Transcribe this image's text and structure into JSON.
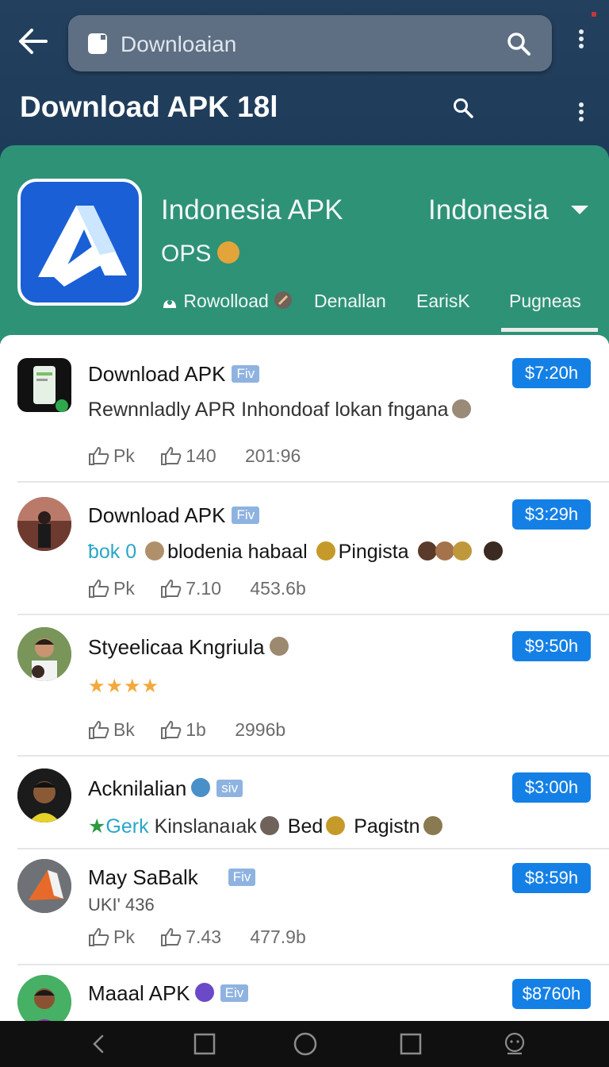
{
  "search": {
    "placeholder": "Downloaian"
  },
  "header": {
    "title": "Download APK 18l"
  },
  "app": {
    "name": "Indonesia APK",
    "subtitle": "OPS",
    "region": "Indonesia",
    "tabs": [
      "Rowolload",
      "Denallan",
      "EarisK",
      "Pugneas"
    ],
    "active_tab_index": 3
  },
  "colors": {
    "header_bg": "#23405e",
    "hero_bg": "#2e9277",
    "price_bg": "#1480e6",
    "tag_bg": "#8fb3e0"
  },
  "items": [
    {
      "title": "Download APK",
      "tag": "Fiv",
      "price": "$7:20h",
      "desc": "Rewnnladly APR Inhondoaf lokan fngana",
      "likes": "Pk",
      "rating": "140",
      "size": "201:96"
    },
    {
      "title": "Download APK",
      "tag": "Fiv",
      "price": "$3:29h",
      "desc_prefix": "ƀok 0",
      "desc_mid": "blodenia habaal",
      "desc_end": "Pingista",
      "likes": "Pk",
      "rating": "7.10",
      "size": "453.6b"
    },
    {
      "title": "Styeelicaa Kngriula",
      "price": "$9:50h",
      "stars": "★★★★",
      "likes": "Bk",
      "rating": "1b",
      "size": "2996b"
    },
    {
      "title": "Acknilalian",
      "tag": "siv",
      "price": "$3:00h",
      "desc_prefix": "Gerk",
      "desc_mid": "Kinslanaıak",
      "desc_bold1": "Bed",
      "desc_bold2": "Pagistn"
    },
    {
      "title": "May SaBalk",
      "tag": "Fiv",
      "price": "$8:59h",
      "desc": "UKI' 436",
      "likes": "Pk",
      "rating": "7.43",
      "size": "477.9b"
    },
    {
      "title": "Maaal APK",
      "tag": "Eiv",
      "price": "$8760h"
    }
  ],
  "navbar": {
    "icons": [
      "back-icon",
      "home-square-icon",
      "home-circle-icon",
      "recents-icon",
      "assistant-icon"
    ]
  }
}
